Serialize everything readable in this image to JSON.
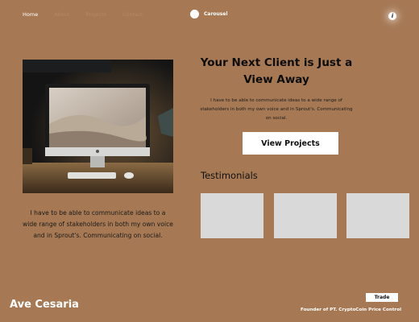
{
  "nav": {
    "items": [
      {
        "label": "Home",
        "active": true
      },
      {
        "label": "",
        "active": false
      },
      {
        "label": "",
        "active": false
      },
      {
        "label": "",
        "active": false
      }
    ],
    "carousel_label": "Carousel",
    "info_glyph": "i"
  },
  "colors": {
    "background": "#a67954",
    "card": "#d9d9d9",
    "button": "#ffffff"
  },
  "hero": {
    "image_icon": "computer-desk-photo",
    "left_text": "I have to be able to communicate ideas to a wide range of stakeholders in both my own voice and in Sprout's. Communicating on social."
  },
  "main": {
    "headline": "Your Next Client is Just a View Away",
    "subtext": "I have to be able to communicate ideas to a wide range of stakeholders in both my own voice and in Sprout's. Communicating on social.",
    "cta_label": "View Projects"
  },
  "testimonials": {
    "title": "Testimonials",
    "cards": [
      "",
      "",
      ""
    ]
  },
  "footer": {
    "brand": "Ave Cesaria",
    "trade_label": "Trade",
    "founder": "Founder of PT. CryptoCoin Price Control"
  }
}
